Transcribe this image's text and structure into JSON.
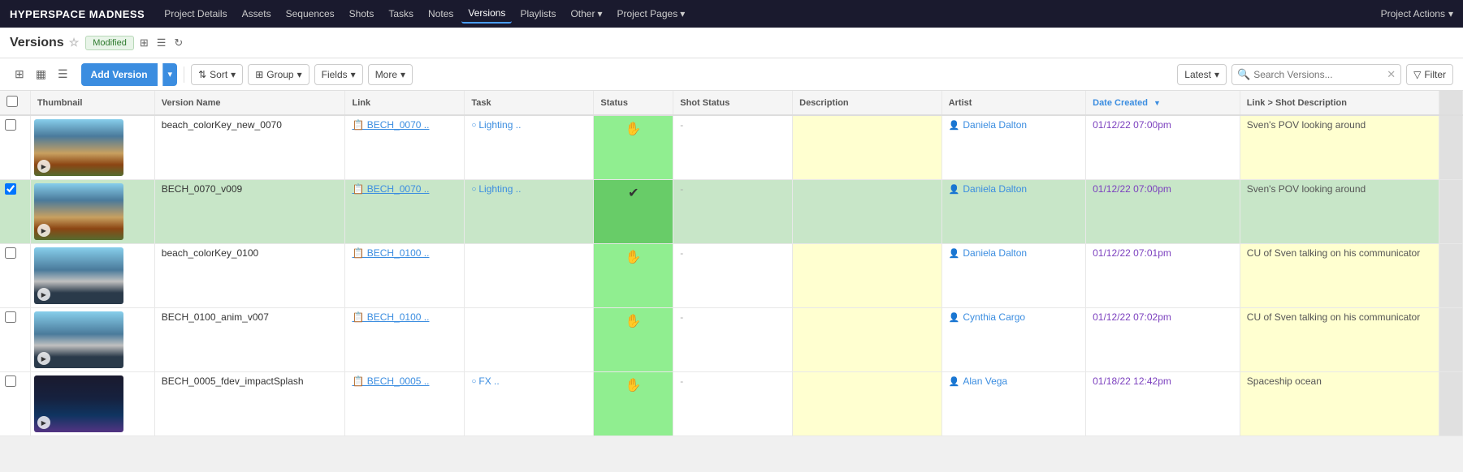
{
  "brand": "HYPERSPACE MADNESS",
  "nav": {
    "items": [
      {
        "label": "Project Details",
        "active": false
      },
      {
        "label": "Assets",
        "active": false
      },
      {
        "label": "Sequences",
        "active": false
      },
      {
        "label": "Shots",
        "active": false
      },
      {
        "label": "Tasks",
        "active": false
      },
      {
        "label": "Notes",
        "active": false
      },
      {
        "label": "Versions",
        "active": true
      },
      {
        "label": "Playlists",
        "active": false
      },
      {
        "label": "Other",
        "active": false,
        "hasArrow": true
      },
      {
        "label": "Project Pages",
        "active": false,
        "hasArrow": true
      }
    ],
    "projectActions": "Project Actions"
  },
  "page": {
    "title": "Versions",
    "modified": "Modified"
  },
  "toolbar": {
    "addVersion": "Add Version",
    "sort": "Sort",
    "group": "Group",
    "fields": "Fields",
    "more": "More",
    "latest": "Latest",
    "searchPlaceholder": "Search Versions...",
    "filter": "Filter"
  },
  "table": {
    "columns": [
      "Thumbnail",
      "Version Name",
      "Link",
      "Task",
      "Status",
      "Shot Status",
      "Description",
      "Artist",
      "Date Created",
      "Link > Shot Description"
    ],
    "rows": [
      {
        "thumb_type": "beach",
        "versionName": "beach_colorKey_new_0070",
        "link": "BECH_0070 ..",
        "task": "Lighting ..",
        "status": "hand",
        "shotStatus": "-",
        "description": "",
        "artist": "Daniela Dalton",
        "dateCreated": "01/12/22 07:00pm",
        "linkDesc": "Sven's POV looking around",
        "selected": false
      },
      {
        "thumb_type": "beach",
        "versionName": "BECH_0070_v009",
        "link": "BECH_0070 ..",
        "task": "Lighting ..",
        "status": "check",
        "shotStatus": "-",
        "description": "",
        "artist": "Daniela Dalton",
        "dateCreated": "01/12/22 07:00pm",
        "linkDesc": "Sven's POV looking around",
        "selected": true
      },
      {
        "thumb_type": "person",
        "versionName": "beach_colorKey_0100",
        "link": "BECH_0100 ..",
        "task": "",
        "status": "hand",
        "shotStatus": "-",
        "description": "",
        "artist": "Daniela Dalton",
        "dateCreated": "01/12/22 07:01pm",
        "linkDesc": "CU of Sven talking on his communicator",
        "selected": false
      },
      {
        "thumb_type": "person",
        "versionName": "BECH_0100_anim_v007",
        "link": "BECH_0100 ..",
        "task": "",
        "status": "hand",
        "shotStatus": "-",
        "description": "",
        "artist": "Cynthia Cargo",
        "dateCreated": "01/12/22 07:02pm",
        "linkDesc": "CU of Sven talking on his communicator",
        "selected": false
      },
      {
        "thumb_type": "dark",
        "versionName": "BECH_0005_fdev_impactSplash",
        "link": "BECH_0005 ..",
        "task": "FX ..",
        "status": "hand",
        "shotStatus": "-",
        "description": "",
        "artist": "Alan Vega",
        "dateCreated": "01/18/22 12:42pm",
        "linkDesc": "Spaceship ocean",
        "selected": false
      }
    ]
  }
}
